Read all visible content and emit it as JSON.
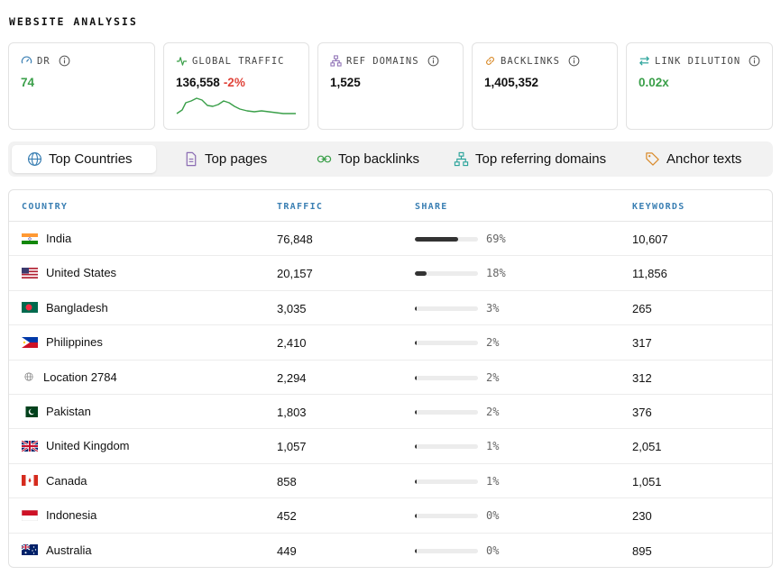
{
  "section_title": "WEBSITE ANALYSIS",
  "metrics": {
    "dr": {
      "label": "DR",
      "value": "74"
    },
    "global_traffic": {
      "label": "GLOBAL TRAFFIC",
      "value": "136,558",
      "change": "-2%"
    },
    "ref_domains": {
      "label": "REF DOMAINS",
      "value": "1,525"
    },
    "backlinks": {
      "label": "BACKLINKS",
      "value": "1,405,352"
    },
    "link_dilution": {
      "label": "LINK DILUTION",
      "value": "0.02x"
    }
  },
  "tabs": [
    {
      "label": "Top Countries",
      "icon": "globe-icon",
      "active": true
    },
    {
      "label": "Top pages",
      "icon": "document-icon",
      "active": false
    },
    {
      "label": "Top backlinks",
      "icon": "link-icon",
      "active": false
    },
    {
      "label": "Top referring domains",
      "icon": "sitemap-icon",
      "active": false
    },
    {
      "label": "Anchor texts",
      "icon": "tag-icon",
      "active": false
    }
  ],
  "table": {
    "headers": {
      "country": "COUNTRY",
      "traffic": "TRAFFIC",
      "share": "SHARE",
      "keywords": "KEYWORDS"
    },
    "rows": [
      {
        "country": "India",
        "flag": "in",
        "traffic": "76,848",
        "share": "69%",
        "share_value": 0.69,
        "keywords": "10,607"
      },
      {
        "country": "United States",
        "flag": "us",
        "traffic": "20,157",
        "share": "18%",
        "share_value": 0.18,
        "keywords": "11,856"
      },
      {
        "country": "Bangladesh",
        "flag": "bd",
        "traffic": "3,035",
        "share": "3%",
        "share_value": 0.03,
        "keywords": "265"
      },
      {
        "country": "Philippines",
        "flag": "ph",
        "traffic": "2,410",
        "share": "2%",
        "share_value": 0.02,
        "keywords": "317"
      },
      {
        "country": "Location 2784",
        "flag": "globe",
        "traffic": "2,294",
        "share": "2%",
        "share_value": 0.02,
        "keywords": "312"
      },
      {
        "country": "Pakistan",
        "flag": "pk",
        "traffic": "1,803",
        "share": "2%",
        "share_value": 0.02,
        "keywords": "376"
      },
      {
        "country": "United Kingdom",
        "flag": "gb",
        "traffic": "1,057",
        "share": "1%",
        "share_value": 0.01,
        "keywords": "2,051"
      },
      {
        "country": "Canada",
        "flag": "ca",
        "traffic": "858",
        "share": "1%",
        "share_value": 0.01,
        "keywords": "1,051"
      },
      {
        "country": "Indonesia",
        "flag": "id",
        "traffic": "452",
        "share": "0%",
        "share_value": 0.0,
        "keywords": "230"
      },
      {
        "country": "Australia",
        "flag": "au",
        "traffic": "449",
        "share": "0%",
        "share_value": 0.0,
        "keywords": "895"
      }
    ]
  },
  "colors": {
    "positive": "#3a9f49",
    "negative": "#e0443a",
    "header_text": "#3a7fb3"
  }
}
